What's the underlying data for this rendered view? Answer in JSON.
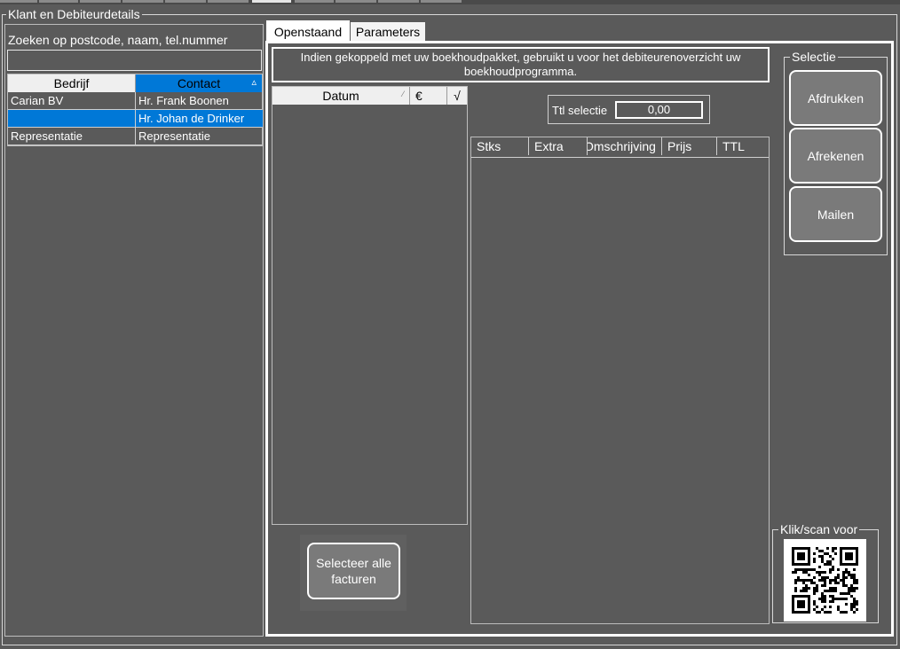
{
  "window": {
    "group_title": "Klant en Debiteurdetails"
  },
  "search": {
    "label": "Zoeken op postcode, naam, tel.nummer",
    "value": "",
    "placeholder": ""
  },
  "customer_grid": {
    "columns": [
      "Bedrijf",
      "Contact"
    ],
    "sort_indicator": "▵",
    "rows": [
      {
        "bedrijf": "Carian BV",
        "contact": "Hr. Frank Boonen",
        "selected": false
      },
      {
        "bedrijf": "",
        "contact": "Hr. Johan de Drinker",
        "selected": true
      },
      {
        "bedrijf": "Representatie",
        "contact": "Representatie",
        "selected": false
      }
    ]
  },
  "tabs": [
    {
      "label": "Openstaand",
      "active": true
    },
    {
      "label": "Parameters",
      "active": false
    }
  ],
  "info_text": "Indien gekoppeld met  uw boekhoudpakket, gebruikt u voor het debiteurenoverzicht uw boekhoudprogramma.",
  "invoice_grid": {
    "columns": [
      "Datum",
      "€",
      "√"
    ],
    "sort_indicator": "⁄"
  },
  "total": {
    "label": "Ttl selectie",
    "value": "0,00"
  },
  "lines_grid": {
    "columns": [
      "Stks",
      "Extra",
      "Omschrijving",
      "Prijs",
      "TTL"
    ]
  },
  "select_all_button": "Selecteer alle facturen",
  "selectie": {
    "title": "Selectie",
    "buttons": [
      "Afdrukken",
      "Afrekenen",
      "Mailen"
    ]
  },
  "qr": {
    "title": "Klik/scan voor"
  },
  "colors": {
    "background": "#5a5a5a",
    "selection": "#0078d7",
    "button": "#7a7a7a"
  }
}
